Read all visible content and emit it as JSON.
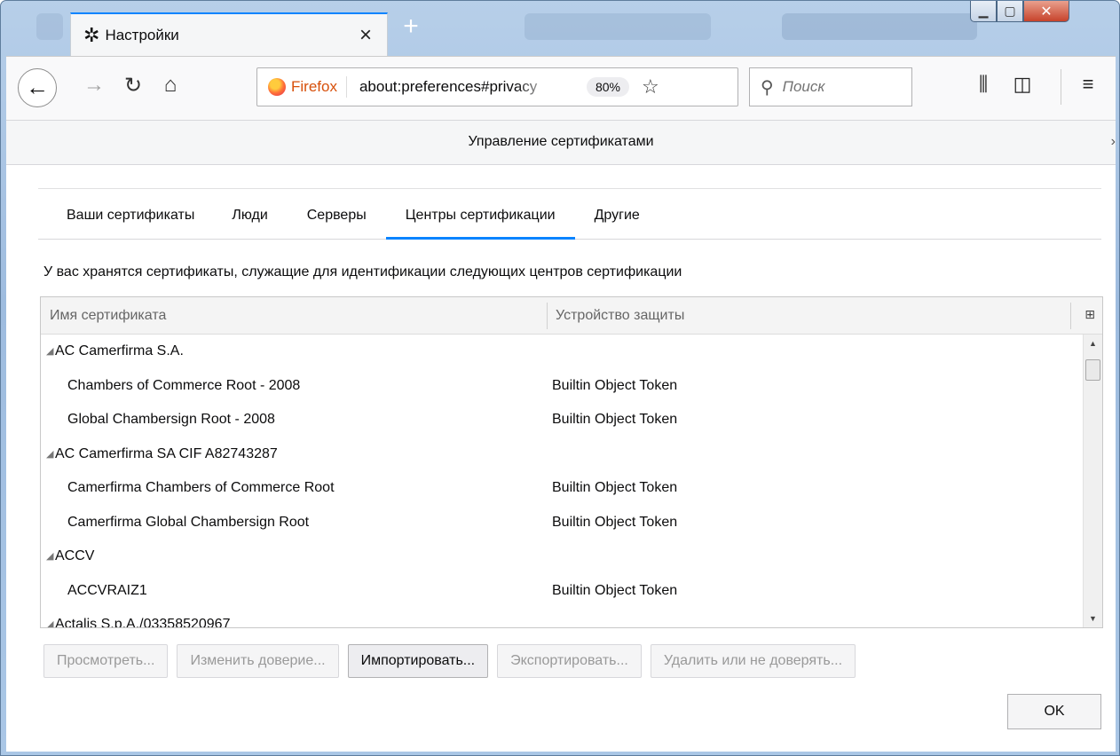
{
  "browser": {
    "tab_title": "Настройки",
    "tab_close": "×",
    "new_tab": "+",
    "identity_label": "Firefox",
    "url": "about:preferences#privacy",
    "zoom": "80%",
    "search_placeholder": "Поиск"
  },
  "icons": {
    "gear": "gear-icon",
    "back": "arrow-left-icon",
    "forward": "arrow-right-icon",
    "reload": "reload-icon",
    "home": "home-icon",
    "star": "bookmark-star-icon",
    "search": "search-icon",
    "library": "library-icon",
    "sidebar": "sidebar-icon",
    "menu": "hamburger-menu-icon"
  },
  "dialog": {
    "title": "Управление сертификатами",
    "tabs": [
      {
        "label": "Ваши сертификаты"
      },
      {
        "label": "Люди"
      },
      {
        "label": "Серверы"
      },
      {
        "label": "Центры сертификации",
        "active": true
      },
      {
        "label": "Другие"
      }
    ],
    "description": "У вас хранятся сертификаты, служащие для идентификации следующих центров сертификации",
    "columns": {
      "name": "Имя сертификата",
      "device": "Устройство защиты"
    },
    "rows": [
      {
        "type": "group",
        "name": "AC Camerfirma S.A.",
        "device": ""
      },
      {
        "type": "cert",
        "name": "Chambers of Commerce Root - 2008",
        "device": "Builtin Object Token"
      },
      {
        "type": "cert",
        "name": "Global Chambersign Root - 2008",
        "device": "Builtin Object Token"
      },
      {
        "type": "group",
        "name": "AC Camerfirma SA CIF A82743287",
        "device": ""
      },
      {
        "type": "cert",
        "name": "Camerfirma Chambers of Commerce Root",
        "device": "Builtin Object Token"
      },
      {
        "type": "cert",
        "name": "Camerfirma Global Chambersign Root",
        "device": "Builtin Object Token"
      },
      {
        "type": "group",
        "name": "ACCV",
        "device": ""
      },
      {
        "type": "cert",
        "name": "ACCVRAIZ1",
        "device": "Builtin Object Token"
      },
      {
        "type": "group",
        "name": "Actalis S.p.A./03358520967",
        "device": ""
      }
    ],
    "buttons": {
      "view": {
        "label": "Просмотреть...",
        "enabled": false
      },
      "edit_trust": {
        "label": "Изменить доверие...",
        "enabled": false
      },
      "import": {
        "label": "Импортировать...",
        "enabled": true
      },
      "export": {
        "label": "Экспортировать...",
        "enabled": false
      },
      "delete": {
        "label": "Удалить или не доверять...",
        "enabled": false
      }
    },
    "ok_label": "OK"
  }
}
